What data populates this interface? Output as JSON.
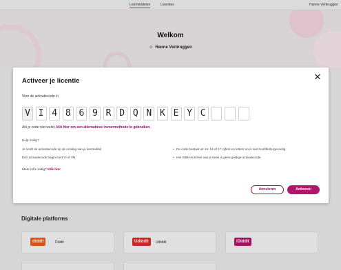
{
  "nav": {
    "tabs": [
      {
        "label": "Leermiddelen",
        "active": true
      },
      {
        "label": "Licenties",
        "active": false
      }
    ],
    "user": "Hanne Verbruggen"
  },
  "hero": {
    "title": "Welkom",
    "user": "Hanne Verbruggen",
    "user_icon": "person-icon"
  },
  "platforms": {
    "title": "Digitale platforms",
    "cards": [
      {
        "logo": "diddit",
        "name": "Diddit",
        "color": "#e85d1e"
      },
      {
        "logo": "Udiddit",
        "name": "Udiddit",
        "color": "#d92b2b"
      },
      {
        "logo": "iDiddit",
        "name": "",
        "color": "#b0176b"
      }
    ]
  },
  "modal": {
    "title": "Activeer je licentie",
    "close_icon": "close-icon",
    "prompt": "Voer de activatiecode in",
    "code": [
      "V",
      "I",
      "4",
      "8",
      "6",
      "9",
      "R",
      "D",
      "Q",
      "N",
      "K",
      "E",
      "Y",
      "C",
      "",
      "",
      ""
    ],
    "hint_prefix": "Als je code niet werkt,",
    "hint_link": "klik hier om een alternatieve invoermethode te gebruiken.",
    "help_title": "Hulp nodig?",
    "help_left": [
      "Je vindt de activatiecode op de omslag van je leermiddel",
      "Een activatiecode begint met VI of VN"
    ],
    "help_right": [
      "De code bestaat uit 14, 16 of 17 cijfers en letters en is niet hoofdlettergevoelig",
      "Het ISBN-nummer van je boek is geen geldige activatiecode"
    ],
    "more_info_prefix": "Meer info nodig?",
    "more_info_link": "Klik hier",
    "cancel_label": "Annuleren",
    "activate_label": "Activeren"
  },
  "colors": {
    "accent": "#b0176b",
    "link": "#a4005d"
  }
}
